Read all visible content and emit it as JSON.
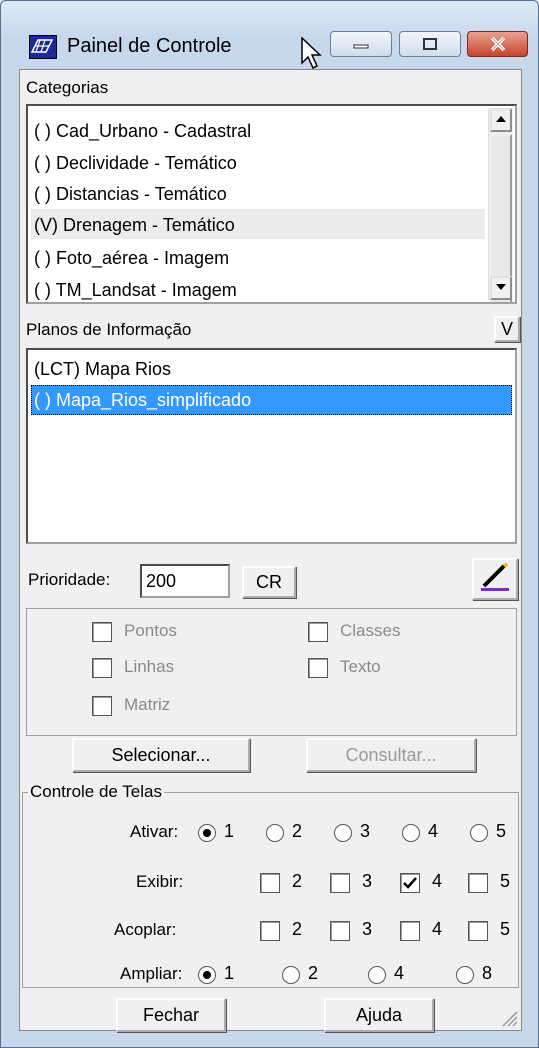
{
  "window": {
    "title": "Painel de Controle"
  },
  "categorias": {
    "label": "Categorias",
    "items": [
      "( ) Cad_Urbano - Cadastral",
      "( ) Declividade - Temático",
      "( ) Distancias - Temático",
      "(V) Drenagem - Temático",
      "( ) Foto_aérea - Imagem",
      "( ) TM_Landsat - Imagem"
    ],
    "selected_index": 3
  },
  "planos": {
    "label": "Planos de Informação",
    "v_button": "V",
    "items": [
      "(LCT) Mapa Rios",
      "( ) Mapa_Rios_simplificado"
    ],
    "highlighted_index": 1
  },
  "prioridade": {
    "label": "Prioridade:",
    "value": "200",
    "cr_button": "CR"
  },
  "options": {
    "pontos": "Pontos",
    "classes": "Classes",
    "linhas": "Linhas",
    "texto": "Texto",
    "matriz": "Matriz"
  },
  "buttons": {
    "selecionar": "Selecionar...",
    "consultar": "Consultar...",
    "fechar": "Fechar",
    "ajuda": "Ajuda"
  },
  "controle": {
    "legend": "Controle de Telas",
    "ativar_label": "Ativar:",
    "exibir_label": "Exibir:",
    "acoplar_label": "Acoplar:",
    "ampliar_label": "Ampliar:",
    "ativar_opts": [
      "1",
      "2",
      "3",
      "4",
      "5"
    ],
    "ativar_selected": "1",
    "exibir_opts": [
      "2",
      "3",
      "4",
      "5"
    ],
    "exibir_checked": [
      "4"
    ],
    "acoplar_opts": [
      "2",
      "3",
      "4",
      "5"
    ],
    "ampliar_opts": [
      "1",
      "2",
      "4",
      "8"
    ],
    "ampliar_selected": "1"
  }
}
